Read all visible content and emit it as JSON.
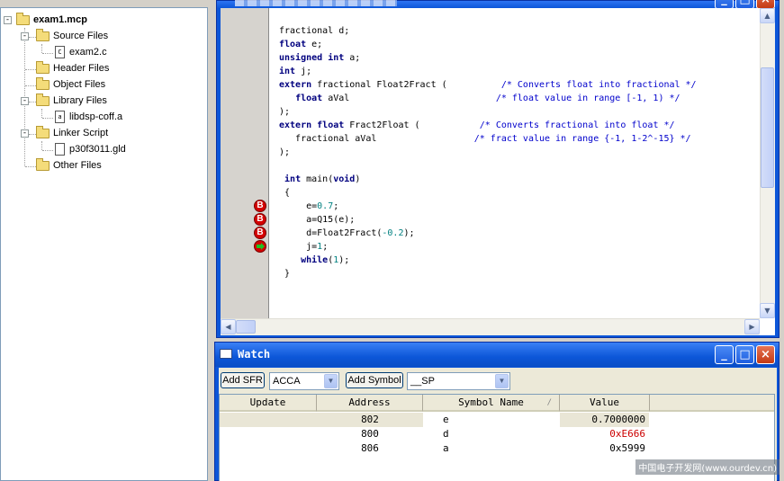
{
  "project": {
    "root": "exam1.mcp",
    "nodes": [
      {
        "label": "Source Files",
        "type": "folder"
      },
      {
        "label": "exam2.c",
        "type": "file",
        "icon": "c-file-icon"
      },
      {
        "label": "Header Files",
        "type": "folder"
      },
      {
        "label": "Object Files",
        "type": "folder"
      },
      {
        "label": "Library Files",
        "type": "folder"
      },
      {
        "label": "libdsp-coff.a",
        "type": "file",
        "icon": "library-file-icon"
      },
      {
        "label": "Linker Script",
        "type": "folder"
      },
      {
        "label": "p30f3011.gld",
        "type": "file",
        "icon": "text-file-icon"
      },
      {
        "label": "Other Files",
        "type": "folder"
      }
    ],
    "expand_sign": "-",
    "c_glyph": "C",
    "a_glyph": "a"
  },
  "editor": {
    "breakpoint_glyph": "B",
    "lines": [
      [
        {
          "t": "fractional d;",
          "c": ""
        }
      ],
      [
        {
          "t": "float",
          "c": "kw"
        },
        {
          "t": " e;",
          "c": ""
        }
      ],
      [
        {
          "t": "unsigned",
          "c": "kw"
        },
        {
          "t": " ",
          "c": ""
        },
        {
          "t": "int",
          "c": "kw"
        },
        {
          "t": " a;",
          "c": ""
        }
      ],
      [
        {
          "t": "int",
          "c": "kw"
        },
        {
          "t": " j;",
          "c": ""
        }
      ],
      [
        {
          "t": "extern",
          "c": "kw"
        },
        {
          "t": " fractional Float2Fract (          ",
          "c": ""
        },
        {
          "t": "/* Converts float into fractional */",
          "c": "cm"
        }
      ],
      [
        {
          "t": "   ",
          "c": ""
        },
        {
          "t": "float",
          "c": "kw"
        },
        {
          "t": " aVal                           ",
          "c": ""
        },
        {
          "t": "/* float value in range [-1, 1) */",
          "c": "cm"
        }
      ],
      [
        {
          "t": ");",
          "c": ""
        }
      ],
      [
        {
          "t": "extern",
          "c": "kw"
        },
        {
          "t": " ",
          "c": ""
        },
        {
          "t": "float",
          "c": "kw"
        },
        {
          "t": " Fract2Float (           ",
          "c": ""
        },
        {
          "t": "/* Converts fractional into float */",
          "c": "cm"
        }
      ],
      [
        {
          "t": "   fractional aVal                  ",
          "c": ""
        },
        {
          "t": "/* fract value in range {-1, 1-2^-15} */",
          "c": "cm"
        }
      ],
      [
        {
          "t": ");",
          "c": ""
        }
      ],
      [
        {
          "t": "",
          "c": ""
        }
      ],
      [
        {
          "t": " ",
          "c": ""
        },
        {
          "t": "int",
          "c": "kw"
        },
        {
          "t": " main(",
          "c": ""
        },
        {
          "t": "void",
          "c": "kw"
        },
        {
          "t": ")",
          "c": ""
        }
      ],
      [
        {
          "t": " {",
          "c": ""
        }
      ],
      [
        {
          "t": "     e=",
          "c": ""
        },
        {
          "t": "0.7",
          "c": "num"
        },
        {
          "t": ";",
          "c": ""
        }
      ],
      [
        {
          "t": "     a=Q15(e);",
          "c": ""
        }
      ],
      [
        {
          "t": "     d=Float2Fract(",
          "c": ""
        },
        {
          "t": "-0.2",
          "c": "num"
        },
        {
          "t": ");",
          "c": ""
        }
      ],
      [
        {
          "t": "     j=",
          "c": ""
        },
        {
          "t": "1",
          "c": "num"
        },
        {
          "t": ";",
          "c": ""
        }
      ],
      [
        {
          "t": "    ",
          "c": ""
        },
        {
          "t": "while",
          "c": "kw"
        },
        {
          "t": "(",
          "c": ""
        },
        {
          "t": "1",
          "c": "num"
        },
        {
          "t": ");",
          "c": ""
        }
      ],
      [
        {
          "t": " }",
          "c": ""
        }
      ]
    ],
    "markers": [
      {
        "line": 13,
        "kind": "breakpoint"
      },
      {
        "line": 14,
        "kind": "breakpoint"
      },
      {
        "line": 15,
        "kind": "breakpoint"
      },
      {
        "line": 16,
        "kind": "program-counter"
      }
    ]
  },
  "watch": {
    "title": "Watch",
    "add_sfr_label": "Add SFR",
    "sfr_value": "ACCA",
    "add_symbol_label": "Add Symbol",
    "symbol_value": "__SP",
    "columns": [
      "Update",
      "Address",
      "Symbol Name",
      "Value"
    ],
    "sort_glyph": "/",
    "rows": [
      {
        "update": "",
        "address": "802",
        "symbol": "e",
        "value": "0.7000000",
        "changed": false
      },
      {
        "update": "",
        "address": "800",
        "symbol": "d",
        "value": "0xE666",
        "changed": true
      },
      {
        "update": "",
        "address": "806",
        "symbol": "a",
        "value": "0x5999",
        "changed": false
      }
    ]
  },
  "window_buttons": {
    "minimize": "_",
    "maximize": "□",
    "close": "×"
  },
  "scroll_glyphs": {
    "up": "▲",
    "down": "▼",
    "left": "◀",
    "right": "▶"
  },
  "colors": {
    "changed_value": "#cc0000",
    "title_blue": "#0c56d8"
  },
  "watermark": "中国电子开发网(www.ourdev.cn)"
}
